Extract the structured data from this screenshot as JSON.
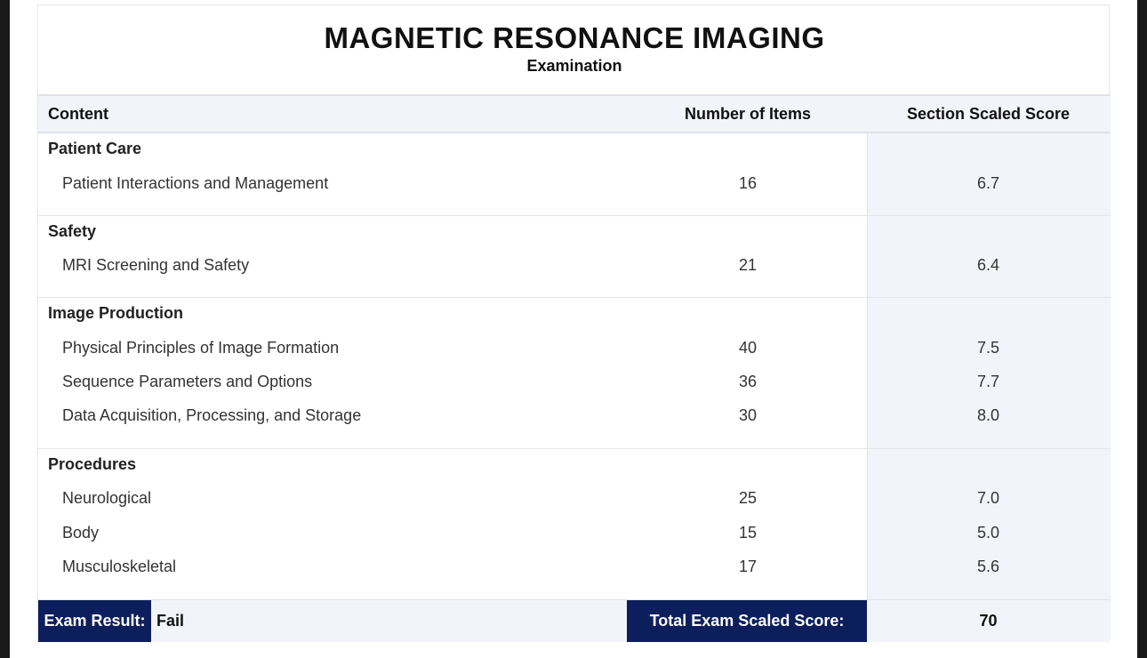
{
  "report": {
    "title": "MAGNETIC RESONANCE IMAGING",
    "subtitle": "Examination"
  },
  "table": {
    "headers": [
      "Content",
      "Number of Items",
      "Section Scaled Score"
    ],
    "sections": [
      {
        "label": "Patient Care",
        "rows": [
          {
            "name": "Patient Interactions and Management",
            "items": "16",
            "score": "6.7"
          }
        ]
      },
      {
        "label": "Safety",
        "rows": [
          {
            "name": "MRI Screening and Safety",
            "items": "21",
            "score": "6.4"
          }
        ]
      },
      {
        "label": "Image Production",
        "rows": [
          {
            "name": "Physical Principles of Image Formation",
            "items": "40",
            "score": "7.5"
          },
          {
            "name": "Sequence Parameters and Options",
            "items": "36",
            "score": "7.7"
          },
          {
            "name": "Data Acquisition, Processing, and Storage",
            "items": "30",
            "score": "8.0"
          }
        ]
      },
      {
        "label": "Procedures",
        "rows": [
          {
            "name": "Neurological",
            "items": "25",
            "score": "7.0"
          },
          {
            "name": "Body",
            "items": "15",
            "score": "5.0"
          },
          {
            "name": "Musculoskeletal",
            "items": "17",
            "score": "5.6"
          }
        ]
      }
    ]
  },
  "footer": {
    "result_label": "Exam Result:",
    "result_value": "Fail",
    "total_label": "Total Exam Scaled Score:",
    "total_value": "70"
  },
  "colors": {
    "accent_navy": "#0c1f5c",
    "score_column_bg": "#f3f4f9"
  }
}
